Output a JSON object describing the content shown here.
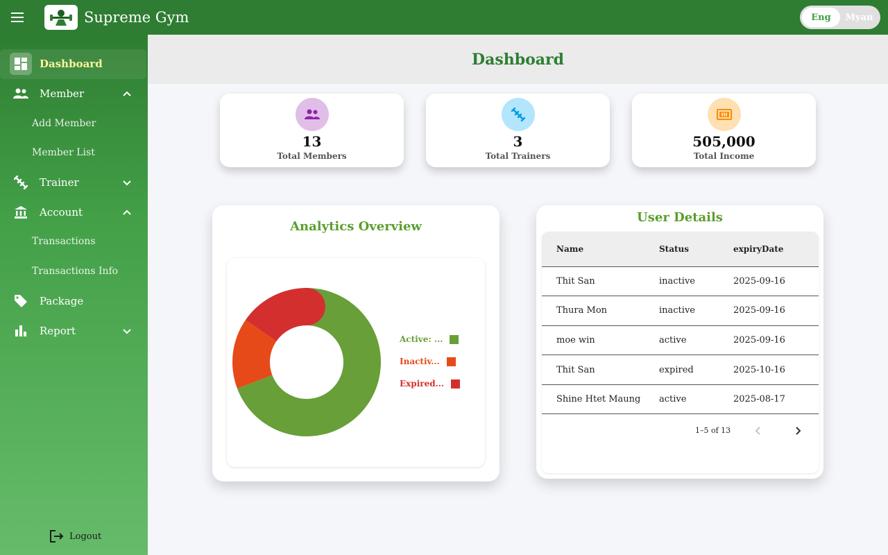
{
  "app": {
    "title": "Supreme Gym",
    "brand_color": "#2e7d32",
    "language": {
      "options": [
        "Eng",
        "Myan"
      ],
      "selected": "Eng"
    }
  },
  "sidebar": {
    "items": [
      {
        "label": "Dashboard",
        "icon": "dashboard-icon",
        "active": true
      },
      {
        "label": "Member",
        "icon": "people-icon",
        "expanded": true,
        "sub": [
          "Add Member",
          "Member List"
        ]
      },
      {
        "label": "Trainer",
        "icon": "dumbbell-icon",
        "expanded": false
      },
      {
        "label": "Account",
        "icon": "bank-icon",
        "expanded": true,
        "sub": [
          "Transactions",
          "Transactions Info"
        ]
      },
      {
        "label": "Package",
        "icon": "tag-icon"
      },
      {
        "label": "Report",
        "icon": "bar-chart-icon",
        "expanded": false
      }
    ],
    "logout_label": "Logout"
  },
  "page": {
    "title": "Dashboard"
  },
  "stats": [
    {
      "value": "13",
      "label": "Total Members",
      "icon": "people-icon",
      "icon_bg": "#e1bee7",
      "icon_color": "#8e24aa"
    },
    {
      "value": "3",
      "label": "Total Trainers",
      "icon": "dumbbell-icon",
      "icon_bg": "#b3e5fc",
      "icon_color": "#039be5"
    },
    {
      "value": "505,000",
      "label": "Total Income",
      "icon": "money-icon",
      "icon_bg": "#ffe0b2",
      "icon_color": "#fb8c00"
    }
  ],
  "analytics": {
    "title": "Analytics Overview",
    "legend": [
      {
        "label": "Active: ...",
        "color": "#689f38"
      },
      {
        "label": "Inactiv...",
        "color": "#e64a19"
      },
      {
        "label": "Expired...",
        "color": "#d32f2f"
      }
    ]
  },
  "chart_data": {
    "type": "pie",
    "donut": true,
    "labels": [
      "Active",
      "Inactive",
      "Expired"
    ],
    "values": [
      9,
      2,
      2
    ],
    "colors": [
      "#689f38",
      "#e64a19",
      "#d32f2f"
    ]
  },
  "user_details": {
    "title": "User Details",
    "columns": [
      "Name",
      "Status",
      "expiryDate"
    ],
    "rows": [
      [
        "Thit San",
        "inactive",
        "2025-09-16"
      ],
      [
        "Thura Mon",
        "inactive",
        "2025-09-16"
      ],
      [
        "moe win",
        "active",
        "2025-09-16"
      ],
      [
        "Thit San",
        "expired",
        "2025-10-16"
      ],
      [
        "Shine Htet Maung",
        "active",
        "2025-08-17"
      ]
    ],
    "pagination": "1–5 of 13"
  }
}
